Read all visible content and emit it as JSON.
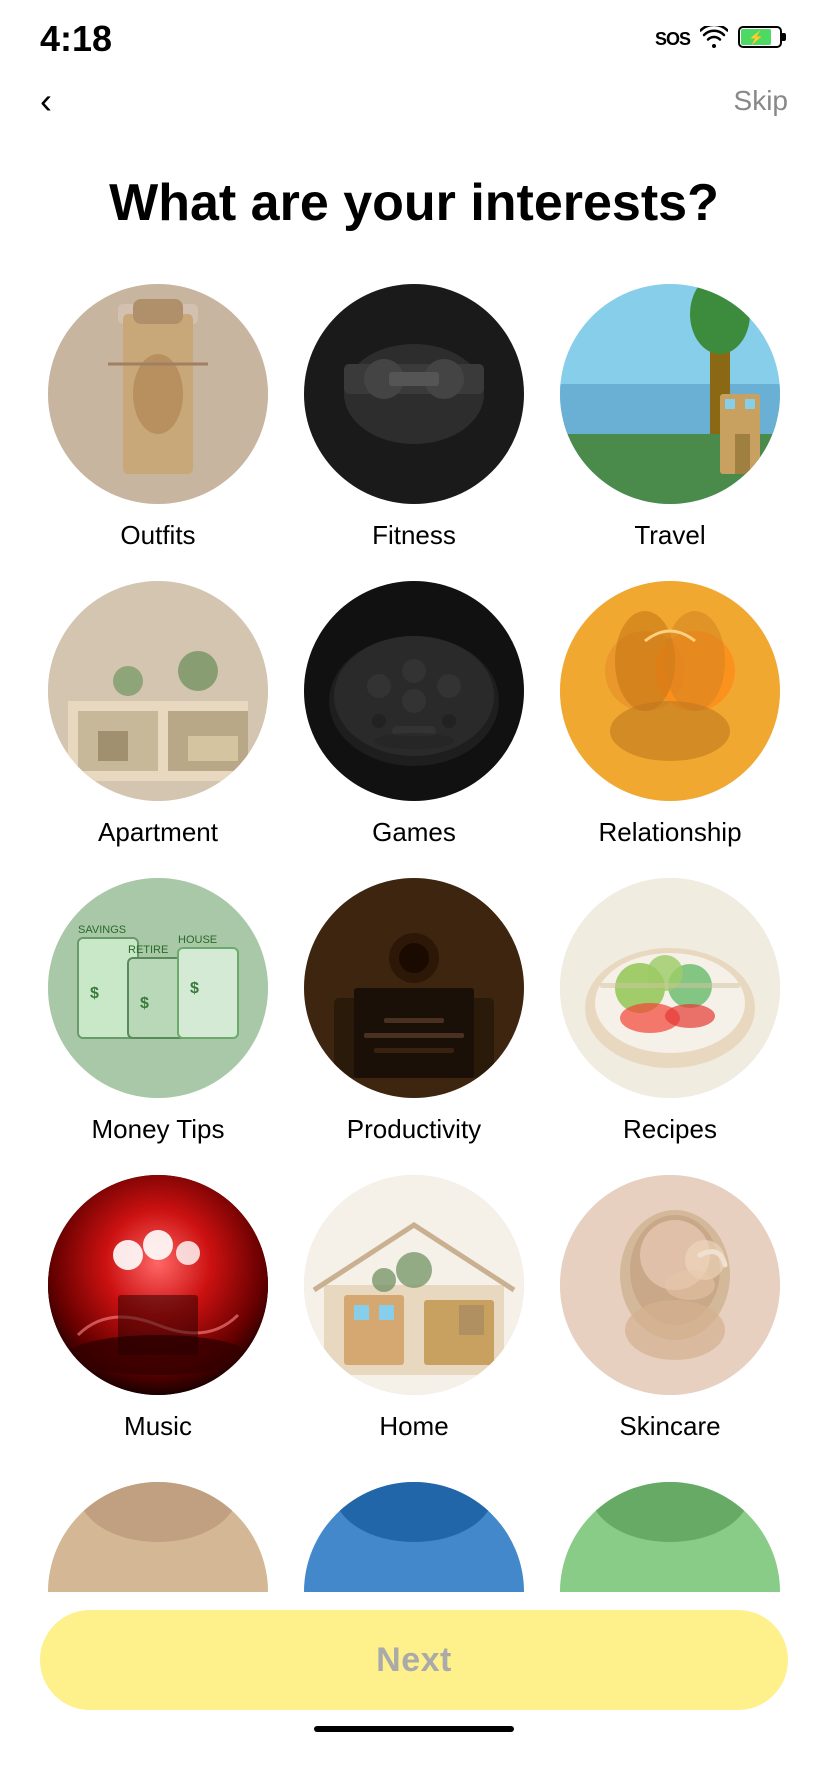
{
  "statusBar": {
    "time": "4:18",
    "sos": "SOS",
    "wifiIcon": "wifi",
    "batteryIcon": "⚡"
  },
  "nav": {
    "backIcon": "‹",
    "skipLabel": "Skip"
  },
  "page": {
    "title": "What are your interests?"
  },
  "interests": [
    {
      "id": "outfits",
      "label": "Outfits",
      "circleClass": "circle-outfits"
    },
    {
      "id": "fitness",
      "label": "Fitness",
      "circleClass": "circle-fitness"
    },
    {
      "id": "travel",
      "label": "Travel",
      "circleClass": "circle-travel"
    },
    {
      "id": "apartment",
      "label": "Apartment",
      "circleClass": "circle-apartment"
    },
    {
      "id": "games",
      "label": "Games",
      "circleClass": "circle-games"
    },
    {
      "id": "relationship",
      "label": "Relationship",
      "circleClass": "circle-relationship"
    },
    {
      "id": "moneytips",
      "label": "Money Tips",
      "circleClass": "circle-moneytips"
    },
    {
      "id": "productivity",
      "label": "Productivity",
      "circleClass": "circle-productivity"
    },
    {
      "id": "recipes",
      "label": "Recipes",
      "circleClass": "circle-recipes"
    },
    {
      "id": "music",
      "label": "Music",
      "circleClass": "circle-music"
    },
    {
      "id": "home",
      "label": "Home",
      "circleClass": "circle-home"
    },
    {
      "id": "skincare",
      "label": "Skincare",
      "circleClass": "circle-skincare"
    }
  ],
  "partialItems": [
    {
      "id": "partial1",
      "circleClass": "partial-outfits2"
    },
    {
      "id": "partial2",
      "circleClass": "partial-fitness2"
    },
    {
      "id": "partial3",
      "circleClass": "partial-travel2"
    }
  ],
  "nextButton": {
    "label": "Next"
  }
}
